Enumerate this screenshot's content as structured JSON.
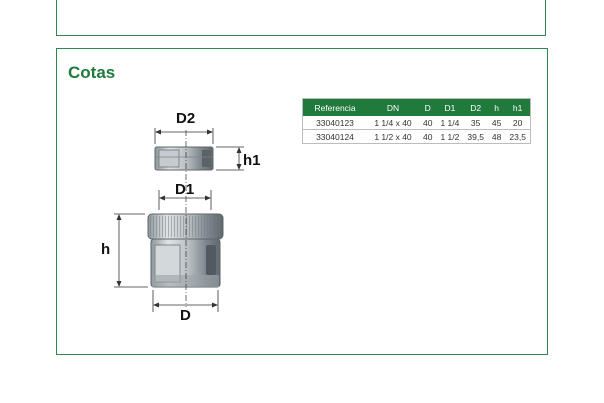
{
  "section_title": "Cotas",
  "drawing_labels": {
    "d2": "D2",
    "h1": "h1",
    "d1": "D1",
    "h": "h",
    "d": "D"
  },
  "table": {
    "headers": [
      "Referencia",
      "DN",
      "D",
      "D1",
      "D2",
      "h",
      "h1"
    ],
    "rows": [
      [
        "33040123",
        "1 1/4 x 40",
        "40",
        "1 1/4",
        "35",
        "45",
        "20"
      ],
      [
        "33040124",
        "1 1/2 x 40",
        "40",
        "1 1/2",
        "39,5",
        "48",
        "23,5"
      ]
    ]
  },
  "colors": {
    "accent_green": "#1f7a3c",
    "border_green": "#2e8a4c"
  }
}
